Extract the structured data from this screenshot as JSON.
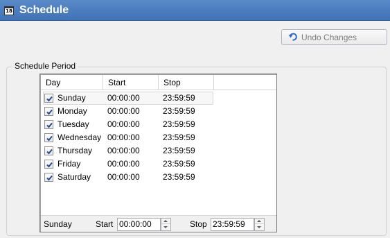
{
  "header": {
    "icon_text": "18",
    "title": "Schedule"
  },
  "toolbar": {
    "undo_label": "Undo Changes",
    "undo_enabled": false
  },
  "schedule_period": {
    "label": "Schedule Period",
    "columns": [
      "Day",
      "Start",
      "Stop"
    ],
    "rows": [
      {
        "day": "Sunday",
        "start": "00:00:00",
        "stop": "23:59:59",
        "checked": true
      },
      {
        "day": "Monday",
        "start": "00:00:00",
        "stop": "23:59:59",
        "checked": true
      },
      {
        "day": "Tuesday",
        "start": "00:00:00",
        "stop": "23:59:59",
        "checked": true
      },
      {
        "day": "Wednesday",
        "start": "00:00:00",
        "stop": "23:59:59",
        "checked": true
      },
      {
        "day": "Thursday",
        "start": "00:00:00",
        "stop": "23:59:59",
        "checked": true
      },
      {
        "day": "Friday",
        "start": "00:00:00",
        "stop": "23:59:59",
        "checked": true
      },
      {
        "day": "Saturday",
        "start": "00:00:00",
        "stop": "23:59:59",
        "checked": true
      }
    ],
    "selected_row": 0,
    "editor": {
      "day": "Sunday",
      "start_label": "Start",
      "start_value": "00:00:00",
      "stop_label": "Stop",
      "stop_value": "23:59:59"
    }
  },
  "colors": {
    "title_bar": "#4a7dc0",
    "title_text": "#ffffff",
    "disabled_text": "#7d7d7d",
    "undo_icon": "#2d6bc4"
  },
  "icons": {
    "calendar": "calendar-icon",
    "undo": "undo-icon",
    "checkbox": "check-icon"
  }
}
